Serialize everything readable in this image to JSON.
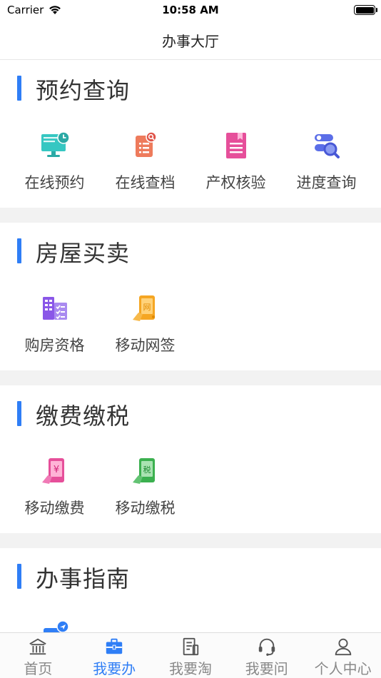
{
  "status_bar": {
    "carrier": "Carrier",
    "time": "10:58 AM"
  },
  "nav": {
    "title": "办事大厅"
  },
  "sections": [
    {
      "title": "预约查询",
      "items": [
        {
          "label": "在线预约",
          "icon": "monitor-clock-icon"
        },
        {
          "label": "在线查档",
          "icon": "document-search-icon"
        },
        {
          "label": "产权核验",
          "icon": "book-icon"
        },
        {
          "label": "进度查询",
          "icon": "progress-search-icon"
        }
      ]
    },
    {
      "title": "房屋买卖",
      "items": [
        {
          "label": "购房资格",
          "icon": "building-check-icon"
        },
        {
          "label": "移动网签",
          "icon": "phone-sign-icon"
        }
      ]
    },
    {
      "title": "缴费缴税",
      "items": [
        {
          "label": "移动缴费",
          "icon": "phone-payment-icon"
        },
        {
          "label": "移动缴税",
          "icon": "phone-tax-icon"
        }
      ]
    },
    {
      "title": "办事指南",
      "items": [
        {
          "label": "",
          "icon": "guide-icon"
        }
      ]
    }
  ],
  "tabs": [
    {
      "label": "首页",
      "icon": "home-icon",
      "active": false
    },
    {
      "label": "我要办",
      "icon": "briefcase-icon",
      "active": true
    },
    {
      "label": "我要淘",
      "icon": "document-icon",
      "active": false
    },
    {
      "label": "我要问",
      "icon": "headset-icon",
      "active": false
    },
    {
      "label": "个人中心",
      "icon": "user-icon",
      "active": false
    }
  ],
  "colors": {
    "accent": "#2f7ef6",
    "tab_inactive": "#888888",
    "divider": "#f2f2f2"
  }
}
